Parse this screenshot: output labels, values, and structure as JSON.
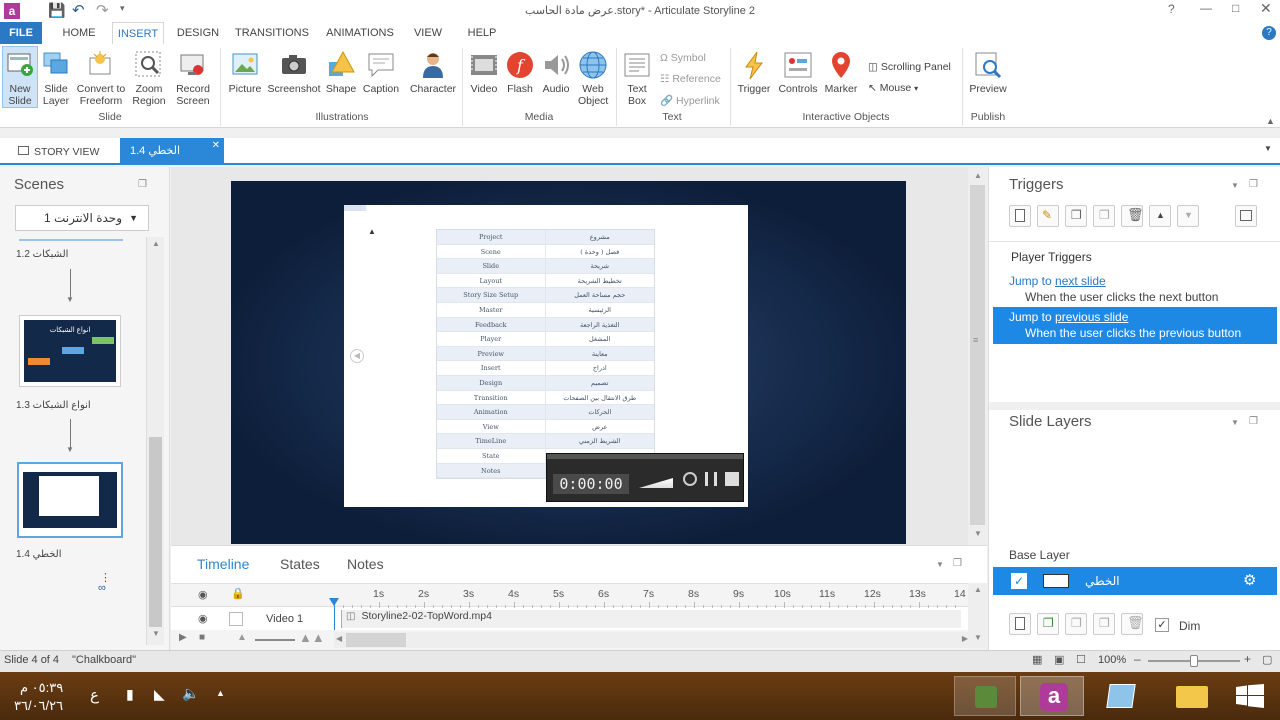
{
  "window": {
    "title": "عرض مادة الحاسب.story* - Articulate Storyline 2"
  },
  "menu": {
    "file": "FILE",
    "home": "HOME",
    "insert": "INSERT",
    "design": "DESIGN",
    "transitions": "TRANSITIONS",
    "animations": "ANIMATIONS",
    "view": "VIEW",
    "help": "HELP"
  },
  "ribbon": {
    "new_slide": "New Slide",
    "slide_layer": "Slide Layer",
    "convert": "Convert to Freeform",
    "zoom": "Zoom Region",
    "record": "Record Screen",
    "picture": "Picture",
    "screenshot": "Screenshot",
    "shape": "Shape",
    "caption": "Caption",
    "character": "Character",
    "video": "Video",
    "flash": "Flash",
    "audio": "Audio",
    "web": "Web Object",
    "textbox": "Text Box",
    "symbol": "Symbol",
    "reference": "Reference",
    "hyperlink": "Hyperlink",
    "trigger": "Trigger",
    "controls": "Controls",
    "marker": "Marker",
    "scrolling": "Scrolling Panel",
    "mouse": "Mouse",
    "preview": "Preview",
    "g_slide": "Slide",
    "g_illustrations": "Illustrations",
    "g_media": "Media",
    "g_text": "Text",
    "g_interactive": "Interactive Objects",
    "g_publish": "Publish"
  },
  "doctabs": {
    "story_view": "STORY VIEW",
    "current": "الخطي 1.4"
  },
  "scenes": {
    "title": "Scenes",
    "dropdown": "وحدة الانترنت 1",
    "s12": "الشبكات 1.2",
    "s13": "انواع الشبكات 1.3",
    "s14": "الخطي 1.4",
    "thumb_title": "انواع الشبكات"
  },
  "slide_table": [
    [
      "Project",
      "مشروع"
    ],
    [
      "Scene",
      "فصل ( وحدة )"
    ],
    [
      "Slide",
      "شريحة"
    ],
    [
      "Layout",
      "تخطيط الشريحة"
    ],
    [
      "Story Size Setup",
      "حجم مساحة العمل"
    ],
    [
      "Master",
      "الرئيسية"
    ],
    [
      "Feedback",
      "التغذية الراجعة"
    ],
    [
      "Player",
      "المشغل"
    ],
    [
      "Preview",
      "معاينة"
    ],
    [
      "Insert",
      "ادراج"
    ],
    [
      "Design",
      "تصميم"
    ],
    [
      "Transition",
      "طرق الانتقال بين الصفحات"
    ],
    [
      "Animation",
      "الحركات"
    ],
    [
      "View",
      "عرض"
    ],
    [
      "TimeLine",
      "الشريط الزمني"
    ],
    [
      "State",
      ""
    ],
    [
      "Notes",
      ""
    ]
  ],
  "recorder": {
    "time": "0:00:00"
  },
  "timeline": {
    "tabs": {
      "timeline": "Timeline",
      "states": "States",
      "notes": "Notes"
    },
    "ticks": [
      "1s",
      "2s",
      "3s",
      "4s",
      "5s",
      "6s",
      "7s",
      "8s",
      "9s",
      "10s",
      "11s",
      "12s",
      "13s",
      "14"
    ],
    "row_label": "Video 1",
    "row_file": "Storyline2-02-TopWord.mp4"
  },
  "triggers": {
    "title": "Triggers",
    "player_triggers": "Player Triggers",
    "t1_prefix": "Jump to",
    "t1_link": "next slide",
    "t1_cond": "When the user clicks the next button",
    "t2_prefix": "Jump to",
    "t2_link": "previous slide",
    "t2_cond": "When the user clicks the previous button"
  },
  "layers": {
    "title": "Slide Layers",
    "base": "Base Layer",
    "base_name": "الخطي",
    "dim": "Dim"
  },
  "status": {
    "slide": "Slide 4 of 4",
    "theme": "\"Chalkboard\"",
    "zoom": "100%"
  },
  "taskbar": {
    "time": "٠٥:٣٩ م",
    "date": "٣٦/٠٦/٢٦",
    "lang": "ع"
  },
  "colors": {
    "accent": "#2b88d8",
    "file_tab": "#2b78c5",
    "selected_trigger": "#1e88e5",
    "stage_bg": "#0d1e3a"
  }
}
